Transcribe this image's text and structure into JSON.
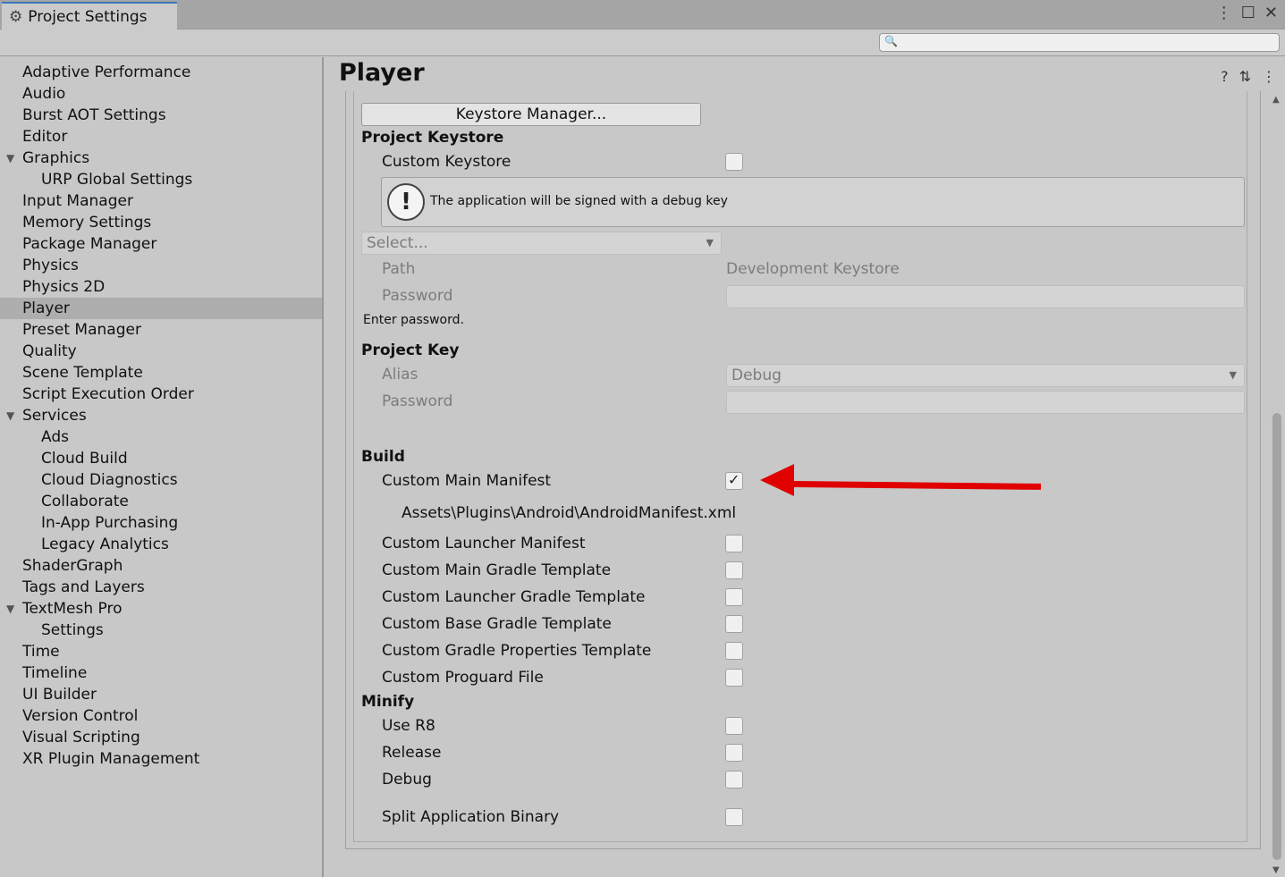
{
  "window": {
    "tab_title": "Project Settings",
    "tab_icon": "gear-icon",
    "controls": [
      "more-icon",
      "maximize-icon",
      "close-icon"
    ]
  },
  "search": {
    "placeholder": ""
  },
  "sidebar": {
    "items": [
      {
        "label": "Adaptive Performance",
        "indent": 0
      },
      {
        "label": "Audio",
        "indent": 0
      },
      {
        "label": "Burst AOT Settings",
        "indent": 0
      },
      {
        "label": "Editor",
        "indent": 0
      },
      {
        "label": "Graphics",
        "indent": 0,
        "expanded": true
      },
      {
        "label": "URP Global Settings",
        "indent": 1
      },
      {
        "label": "Input Manager",
        "indent": 0
      },
      {
        "label": "Memory Settings",
        "indent": 0
      },
      {
        "label": "Package Manager",
        "indent": 0
      },
      {
        "label": "Physics",
        "indent": 0
      },
      {
        "label": "Physics 2D",
        "indent": 0
      },
      {
        "label": "Player",
        "indent": 0,
        "selected": true
      },
      {
        "label": "Preset Manager",
        "indent": 0
      },
      {
        "label": "Quality",
        "indent": 0
      },
      {
        "label": "Scene Template",
        "indent": 0
      },
      {
        "label": "Script Execution Order",
        "indent": 0
      },
      {
        "label": "Services",
        "indent": 0,
        "expanded": true
      },
      {
        "label": "Ads",
        "indent": 1
      },
      {
        "label": "Cloud Build",
        "indent": 1
      },
      {
        "label": "Cloud Diagnostics",
        "indent": 1
      },
      {
        "label": "Collaborate",
        "indent": 1
      },
      {
        "label": "In-App Purchasing",
        "indent": 1
      },
      {
        "label": "Legacy Analytics",
        "indent": 1
      },
      {
        "label": "ShaderGraph",
        "indent": 0
      },
      {
        "label": "Tags and Layers",
        "indent": 0
      },
      {
        "label": "TextMesh Pro",
        "indent": 0,
        "expanded": true
      },
      {
        "label": "Settings",
        "indent": 1
      },
      {
        "label": "Time",
        "indent": 0
      },
      {
        "label": "Timeline",
        "indent": 0
      },
      {
        "label": "UI Builder",
        "indent": 0
      },
      {
        "label": "Version Control",
        "indent": 0
      },
      {
        "label": "Visual Scripting",
        "indent": 0
      },
      {
        "label": "XR Plugin Management",
        "indent": 0
      }
    ]
  },
  "main": {
    "title": "Player",
    "header_icons": [
      "help-icon",
      "preset-icon",
      "more-icon"
    ],
    "keystore_manager_button": "Keystore Manager...",
    "project_keystore": {
      "heading": "Project Keystore",
      "custom_keystore_label": "Custom Keystore",
      "custom_keystore_checked": false,
      "help_message": "The application will be signed with a debug key",
      "select_placeholder": "Select...",
      "path_label": "Path",
      "path_value": "Development Keystore",
      "password_label": "Password",
      "enter_password": "Enter password."
    },
    "project_key": {
      "heading": "Project Key",
      "alias_label": "Alias",
      "alias_value": "Debug",
      "password_label": "Password"
    },
    "build": {
      "heading": "Build",
      "custom_main_manifest": {
        "label": "Custom Main Manifest",
        "checked": true
      },
      "manifest_path": "Assets\\Plugins\\Android\\AndroidManifest.xml",
      "options": [
        {
          "label": "Custom Launcher Manifest",
          "checked": false
        },
        {
          "label": "Custom Main Gradle Template",
          "checked": false
        },
        {
          "label": "Custom Launcher Gradle Template",
          "checked": false
        },
        {
          "label": "Custom Base Gradle Template",
          "checked": false
        },
        {
          "label": "Custom Gradle Properties Template",
          "checked": false
        },
        {
          "label": "Custom Proguard File",
          "checked": false
        }
      ]
    },
    "minify": {
      "heading": "Minify",
      "options": [
        {
          "label": "Use R8",
          "checked": false
        },
        {
          "label": "Release",
          "checked": false
        },
        {
          "label": "Debug",
          "checked": false
        }
      ]
    },
    "split_binary": {
      "label": "Split Application Binary",
      "checked": false
    },
    "annotation_color": "#e00000"
  }
}
